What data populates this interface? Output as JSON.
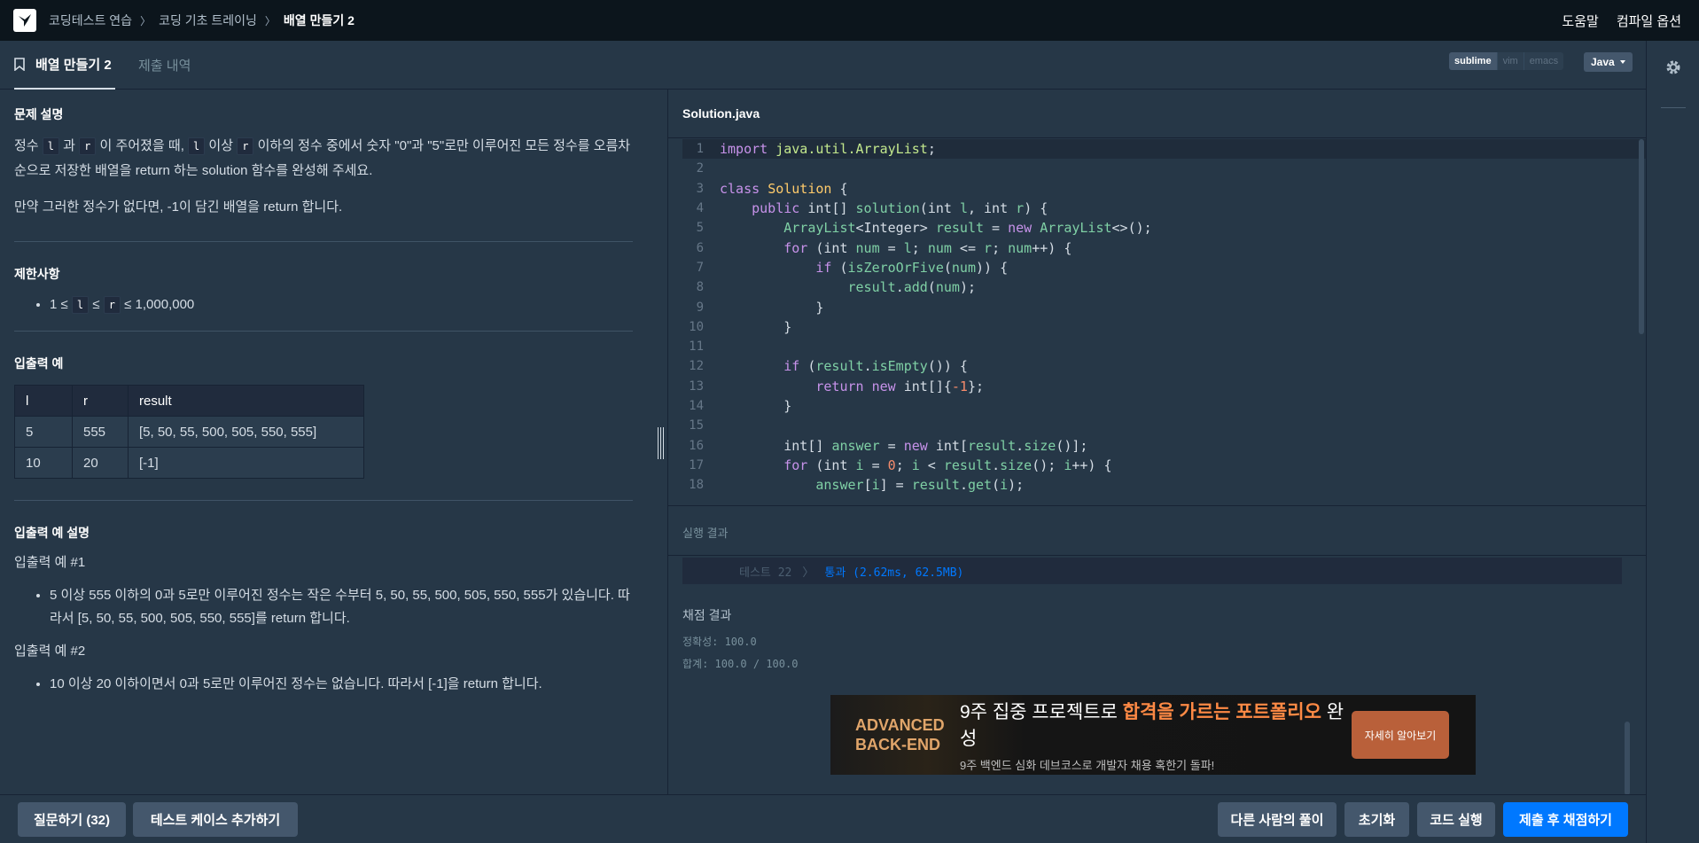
{
  "nav": {
    "breadcrumbs": [
      "코딩테스트 연습",
      "코딩 기초 트레이닝",
      "배열 만들기 2"
    ],
    "help": "도움말",
    "compile_options": "컴파일 옵션"
  },
  "tabs": {
    "active": "배열 만들기 2",
    "inactive": "제출 내역"
  },
  "editor_modes": [
    "sublime",
    "vim",
    "emacs"
  ],
  "language": "Java",
  "problem": {
    "desc_title": "문제 설명",
    "desc_p1_a": "정수 ",
    "l": "l",
    "desc_p1_b": " 과 ",
    "r": "r",
    "desc_p1_c": " 이 주어졌을 때, ",
    "desc_p1_d": " 이상 ",
    "desc_p1_e": " 이하의 정수 중에서 숫자 \"0\"과 \"5\"로만 이루어진 모든 정수를 오름차순으로 저장한 배열을 return 하는 solution 함수를 완성해 주세요.",
    "desc_p2": "만약 그러한 정수가 없다면, -1이 담긴 배열을 return 합니다.",
    "limits_title": "제한사항",
    "limit_a": "1 ≤ ",
    "limit_b": " ≤ ",
    "limit_c": " ≤ 1,000,000",
    "io_title": "입출력 예",
    "table_headers": [
      "l",
      "r",
      "result"
    ],
    "table_rows": [
      [
        "5",
        "555",
        "[5, 50, 55, 500, 505, 550, 555]"
      ],
      [
        "10",
        "20",
        "[-1]"
      ]
    ],
    "io_desc_title": "입출력 예 설명",
    "ex1_title": "입출력 예 #1",
    "ex1_item": "5 이상 555 이하의 0과 5로만 이루어진 정수는 작은 수부터 5, 50, 55, 500, 505, 550, 555가 있습니다. 따라서 [5, 50, 55, 500, 505, 550, 555]를 return 합니다.",
    "ex2_title": "입출력 예 #2",
    "ex2_item": "10 이상 20 이하이면서 0과 5로만 이루어진 정수는 없습니다. 따라서 [-1]을 return 합니다."
  },
  "editor": {
    "filename": "Solution.java",
    "line_numbers": [
      "1",
      "2",
      "3",
      "4",
      "5",
      "6",
      "7",
      "8",
      "9",
      "10",
      "11",
      "12",
      "13",
      "14",
      "15",
      "16",
      "17",
      "18"
    ]
  },
  "output": {
    "title": "실행 결과",
    "test_name": "테스트 22",
    "test_sep": "〉",
    "test_result": "통과 (2.62ms, 62.5MB)",
    "grade_title": "채점 결과",
    "accuracy": "정확성: 100.0",
    "total": "합계: 100.0 / 100.0"
  },
  "ad": {
    "brand_line1": "ADVANCED",
    "brand_line2": "BACK-END",
    "head_a": "9주 집중 프로젝트로 ",
    "head_b": "합격을 가르는 포트폴리오",
    "head_c": " 완성",
    "sub": "9주 백엔드 심화 데브코스로 개발자 채용 혹한기 돌파!",
    "button": "자세히 알아보기"
  },
  "bottom": {
    "ask": "질문하기 (32)",
    "add_testcase": "테스트 케이스 추가하기",
    "others": "다른 사람의 풀이",
    "reset": "초기화",
    "run": "코드 실행",
    "submit": "제출 후 채점하기"
  },
  "colors": {
    "background": "#263747",
    "topnav": "#0c151c",
    "primary": "#0078ff",
    "pass": "#0078ff"
  }
}
